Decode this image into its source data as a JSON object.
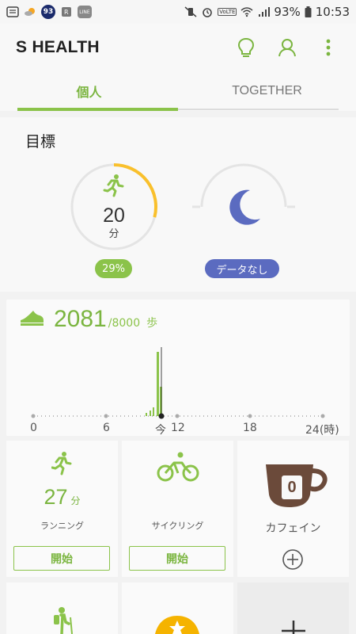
{
  "status_bar": {
    "notif_badge": "93",
    "line_label": "LINE",
    "volte_label": "VoLTE",
    "battery": "93%",
    "time": "10:53"
  },
  "app": {
    "title": "S HEALTH",
    "accent_color": "#8bc34a",
    "actions": [
      "lightbulb-icon",
      "person-icon",
      "more-vertical-icon"
    ]
  },
  "tabs": [
    {
      "label": "個人",
      "active": true
    },
    {
      "label": "TOGETHER",
      "active": false
    }
  ],
  "goals": {
    "title": "目標",
    "activity": {
      "value": "20",
      "unit": "分",
      "progress_label": "29%",
      "progress": 0.29
    },
    "sleep": {
      "status_label": "データなし"
    }
  },
  "steps": {
    "count": "2081",
    "goal": "/8000",
    "unit": "歩",
    "axis_labels": [
      "0",
      "6",
      "今",
      "12",
      "18",
      "24(時)"
    ]
  },
  "tiles": {
    "running": {
      "value": "27",
      "unit": "分",
      "label": "ランニング",
      "button": "開始"
    },
    "cycling": {
      "label": "サイクリング",
      "button": "開始"
    },
    "caffeine": {
      "value": "0",
      "label": "カフェイン"
    }
  }
}
